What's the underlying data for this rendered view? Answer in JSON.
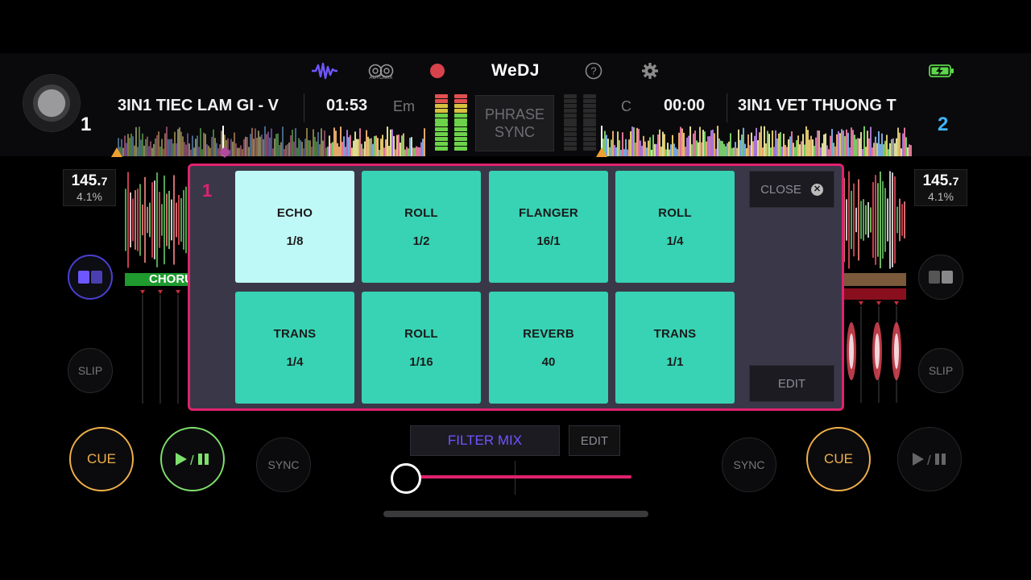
{
  "header": {
    "logo": "WeDJ",
    "automix_label": "AUTOMIX",
    "icons": [
      "waveform-icon",
      "automix-icon",
      "record-icon",
      "help-icon",
      "gear-icon",
      "battery-charging-icon"
    ]
  },
  "deck1": {
    "number": "1",
    "title": "3IN1 TIEC LAM GI - V",
    "time": "01:53",
    "key": "Em",
    "bpm_main": "145.",
    "bpm_decimal": "7",
    "pitch": "4.1%",
    "phrase_label": "CHORUS",
    "slip": "SLIP",
    "cue": "CUE",
    "sync": "SYNC",
    "color": "#e0226e"
  },
  "deck2": {
    "number": "2",
    "title": "3IN1  VET THUONG T",
    "time": "00:00",
    "key": "C",
    "bpm_main": "145.",
    "bpm_decimal": "7",
    "pitch": "4.1%",
    "slip": "SLIP",
    "cue": "CUE",
    "sync": "SYNC",
    "color": "#3fb7ff"
  },
  "phrase_sync": {
    "line1": "PHRASE",
    "line2": "SYNC"
  },
  "fx_panel": {
    "deck_number": "1",
    "close_label": "CLOSE",
    "edit_label": "EDIT",
    "pads": [
      {
        "name": "ECHO",
        "value": "1/8",
        "active": true
      },
      {
        "name": "ROLL",
        "value": "1/2",
        "active": false
      },
      {
        "name": "FLANGER",
        "value": "16/1",
        "active": false
      },
      {
        "name": "ROLL",
        "value": "1/4",
        "active": false
      },
      {
        "name": "TRANS",
        "value": "1/4",
        "active": false
      },
      {
        "name": "ROLL",
        "value": "1/16",
        "active": false
      },
      {
        "name": "REVERB",
        "value": "40",
        "active": false
      },
      {
        "name": "TRANS",
        "value": "1/1",
        "active": false
      }
    ]
  },
  "mixer": {
    "filter_mix_label": "FILTER MIX",
    "edit_label": "EDIT",
    "crossfader_position": 0.0
  },
  "colors": {
    "accent": "#e0226e",
    "pad": "#37d3b4",
    "pad_active": "#bff9f7",
    "cue": "#f0b04a",
    "play": "#7ee06c",
    "filter": "#6e56ff"
  }
}
